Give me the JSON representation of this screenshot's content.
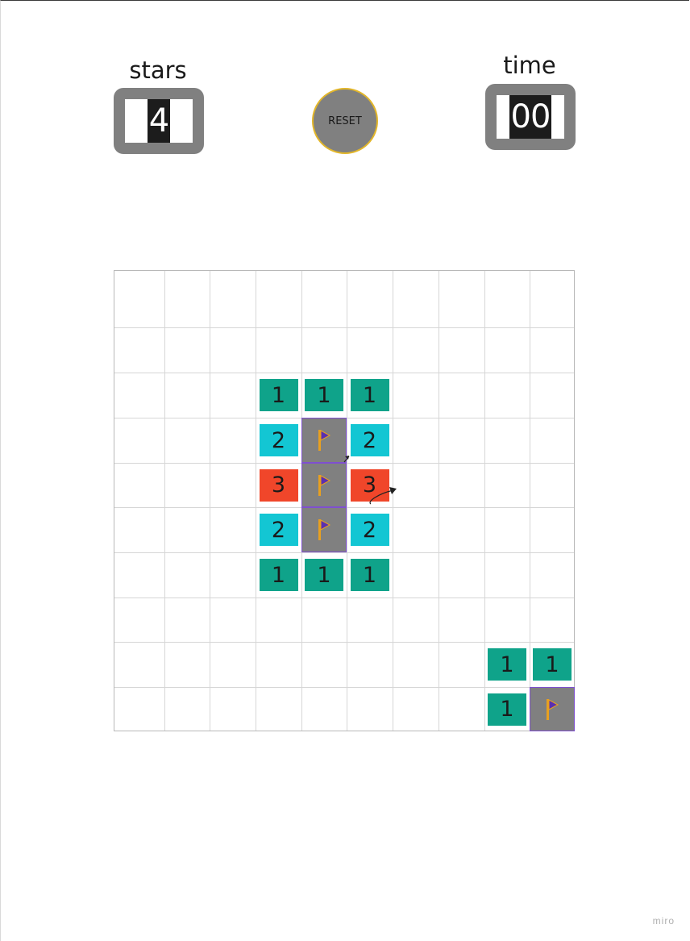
{
  "hud": {
    "stars_label": "stars",
    "stars_value": "4",
    "reset_label": "RESET",
    "time_label": "time",
    "time_value": "00"
  },
  "board": {
    "columns": 10,
    "rows": 10,
    "cells": [
      {
        "row": 2,
        "col": 3,
        "kind": "number",
        "value": "1",
        "color": "#0fa38a"
      },
      {
        "row": 2,
        "col": 4,
        "kind": "number",
        "value": "1",
        "color": "#0fa38a"
      },
      {
        "row": 2,
        "col": 5,
        "kind": "number",
        "value": "1",
        "color": "#0fa38a"
      },
      {
        "row": 3,
        "col": 3,
        "kind": "number",
        "value": "2",
        "color": "#13c6d3"
      },
      {
        "row": 3,
        "col": 4,
        "kind": "flag"
      },
      {
        "row": 3,
        "col": 5,
        "kind": "number",
        "value": "2",
        "color": "#13c6d3"
      },
      {
        "row": 4,
        "col": 3,
        "kind": "number",
        "value": "3",
        "color": "#f0462a"
      },
      {
        "row": 4,
        "col": 4,
        "kind": "flag"
      },
      {
        "row": 4,
        "col": 5,
        "kind": "number",
        "value": "3",
        "color": "#f0462a"
      },
      {
        "row": 5,
        "col": 3,
        "kind": "number",
        "value": "2",
        "color": "#13c6d3"
      },
      {
        "row": 5,
        "col": 4,
        "kind": "flag"
      },
      {
        "row": 5,
        "col": 5,
        "kind": "number",
        "value": "2",
        "color": "#13c6d3"
      },
      {
        "row": 6,
        "col": 3,
        "kind": "number",
        "value": "1",
        "color": "#0fa38a"
      },
      {
        "row": 6,
        "col": 4,
        "kind": "number",
        "value": "1",
        "color": "#0fa38a"
      },
      {
        "row": 6,
        "col": 5,
        "kind": "number",
        "value": "1",
        "color": "#0fa38a"
      },
      {
        "row": 8,
        "col": 8,
        "kind": "number",
        "value": "1",
        "color": "#0fa38a"
      },
      {
        "row": 8,
        "col": 9,
        "kind": "number",
        "value": "1",
        "color": "#0fa38a"
      },
      {
        "row": 9,
        "col": 8,
        "kind": "number",
        "value": "1",
        "color": "#0fa38a"
      },
      {
        "row": 9,
        "col": 9,
        "kind": "flag"
      }
    ]
  },
  "flag_colors": {
    "cell_bg": "#808080",
    "border": "#7f4fd0",
    "pole": "#e8a020",
    "banner": "#5a2fb0"
  },
  "icons": {
    "flag": "flag-icon",
    "arrow": "curved-arrow-icon"
  },
  "watermark": "miro"
}
